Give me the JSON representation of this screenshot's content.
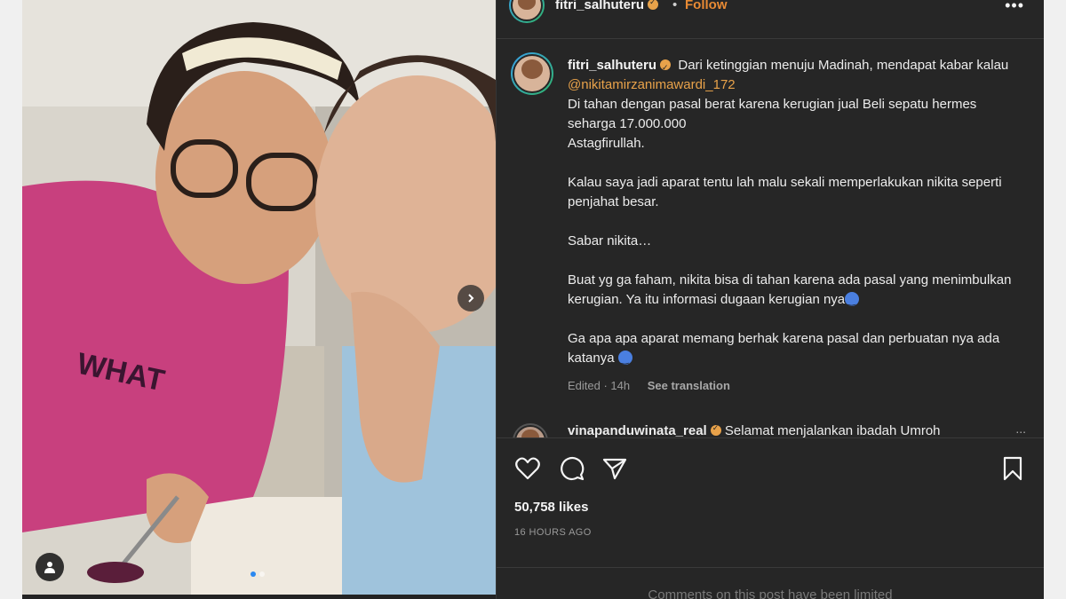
{
  "post": {
    "username": "fitri_salhuteru",
    "follow_label": "Follow",
    "separator": "•",
    "more_icon": "more-horizontal-icon",
    "caption": {
      "username": "fitri_salhuteru",
      "line1": "Dari ketinggian menuju Madinah, mendapat kabar kalau ",
      "mention": "@nikitamirzanimawardi_172",
      "body1": "Di tahan dengan pasal berat karena kerugian jual Beli sepatu hermes seharga 17.000.000\nAstagfirullah.\n\nKalau saya jadi aparat tentu lah malu sekali memperlakukan nikita seperti penjahat besar.\n\nSabar nikita…\n\nBuat yg ga faham, nikita bisa di tahan karena ada pasal yang menimbulkan kerugian. Ya itu informasi dugaan kerugian nya",
      "body2": "\n\nGa apa apa aparat memang berhak karena pasal dan perbuatan nya ada katanya ",
      "edited": "Edited · 14h",
      "see_translation": "See translation"
    },
    "comment": {
      "username": "vinapanduwinata_real",
      "text": "Selamat menjalankan ibadah Umroh",
      "more": "..."
    },
    "likes": "50,758 likes",
    "timestamp": "16 HOURS AGO",
    "comments_limited": "Comments on this post have been limited",
    "carousel": {
      "slides": 2,
      "active_index": 0
    },
    "colors": {
      "follow": "#e88a34",
      "mention": "#e8a24a",
      "verified": "#e8a24a",
      "panel_bg": "#262626",
      "active_dot": "#2b88f0"
    }
  }
}
